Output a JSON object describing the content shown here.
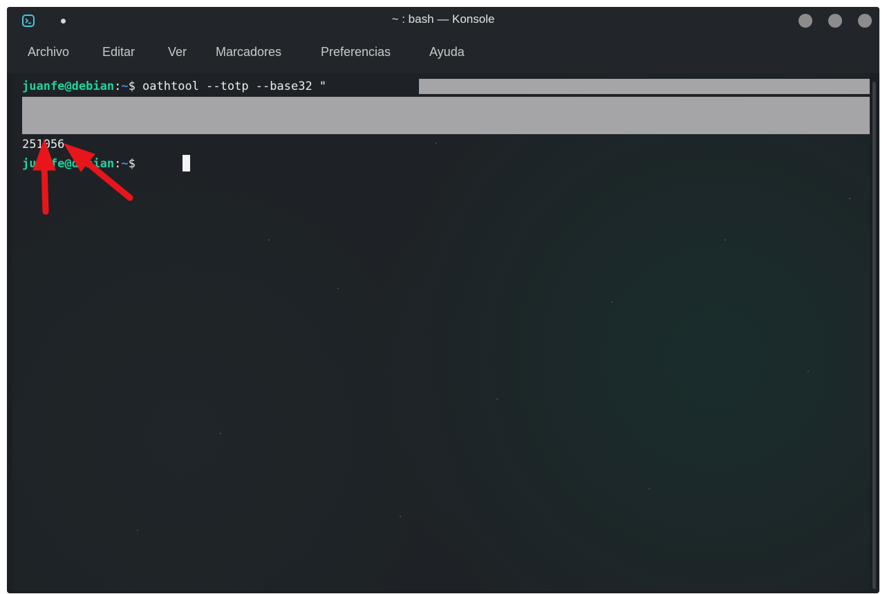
{
  "window": {
    "title": "~ : bash — Konsole",
    "icons": {
      "app": "konsole-terminal-icon",
      "pin": "pin-dot-icon"
    },
    "buttons": [
      "minimize-button",
      "maximize-button",
      "close-button"
    ]
  },
  "menu": {
    "items": [
      "Archivo",
      "Editar",
      "Ver",
      "Marcadores",
      "Preferencias",
      "Ayuda"
    ]
  },
  "terminal": {
    "line1": {
      "user_host": "juanfe@debian",
      "colon": ":",
      "path": "~",
      "prompt_end": "$ ",
      "command": "oathtool --totp --base32 \""
    },
    "output": "251056",
    "line3": {
      "user_host": "juanfe@debian",
      "colon": ":",
      "path": "~",
      "prompt_end": "$ "
    }
  },
  "annotations": {
    "arrow_color": "#e8151b",
    "count": 2
  },
  "colors": {
    "prompt_user": "#1fd3a0",
    "prompt_path": "#4a8de8",
    "redaction": "#a5a4a7"
  }
}
